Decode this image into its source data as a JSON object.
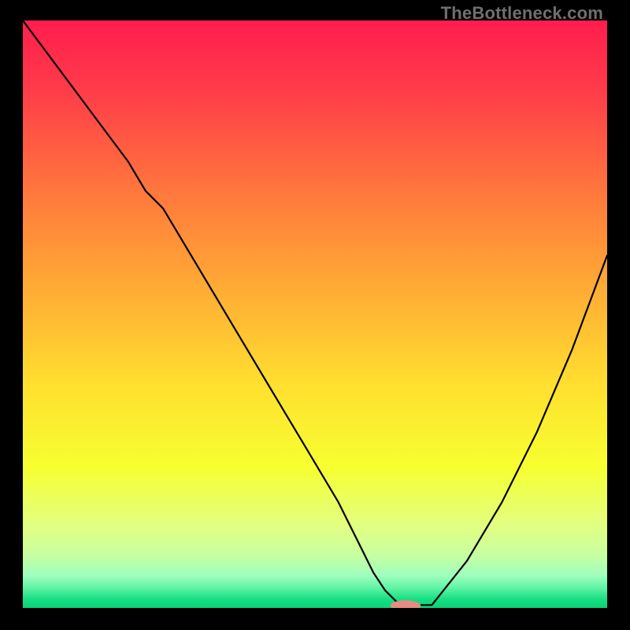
{
  "watermark": "TheBottleneck.com",
  "chart_data": {
    "type": "line",
    "title": "",
    "xlabel": "",
    "ylabel": "",
    "xlim": [
      0,
      100
    ],
    "ylim": [
      0,
      100
    ],
    "grid": false,
    "legend": false,
    "background": {
      "type": "vertical-gradient",
      "stops": [
        {
          "pos": 0.0,
          "color": "#ff1d4e"
        },
        {
          "pos": 0.12,
          "color": "#ff3c49"
        },
        {
          "pos": 0.3,
          "color": "#ff7a3c"
        },
        {
          "pos": 0.48,
          "color": "#ffb334"
        },
        {
          "pos": 0.62,
          "color": "#ffdf2f"
        },
        {
          "pos": 0.76,
          "color": "#f7ff30"
        },
        {
          "pos": 0.86,
          "color": "#e2ff82"
        },
        {
          "pos": 0.91,
          "color": "#c7ffa0"
        },
        {
          "pos": 0.945,
          "color": "#9effbe"
        },
        {
          "pos": 0.965,
          "color": "#63f4a6"
        },
        {
          "pos": 0.985,
          "color": "#17df83"
        },
        {
          "pos": 1.0,
          "color": "#0bd276"
        }
      ]
    },
    "series": [
      {
        "name": "bottleneck-curve",
        "color": "#000000",
        "width": 2.2,
        "x": [
          0,
          6,
          12,
          18,
          21,
          24,
          30,
          36,
          42,
          48,
          54,
          58,
          60,
          62,
          64,
          66,
          70,
          76,
          82,
          88,
          94,
          100
        ],
        "y": [
          100,
          92,
          84,
          76,
          71,
          68,
          58,
          48,
          38,
          28,
          18,
          10,
          6,
          3,
          1,
          0.5,
          0.5,
          8,
          18,
          30,
          44,
          60
        ]
      }
    ],
    "marker": {
      "name": "optimal-marker",
      "shape": "pill",
      "color": "#e58b82",
      "cx": 65.5,
      "cy": 0.4,
      "rx": 2.6,
      "ry": 0.9
    }
  }
}
